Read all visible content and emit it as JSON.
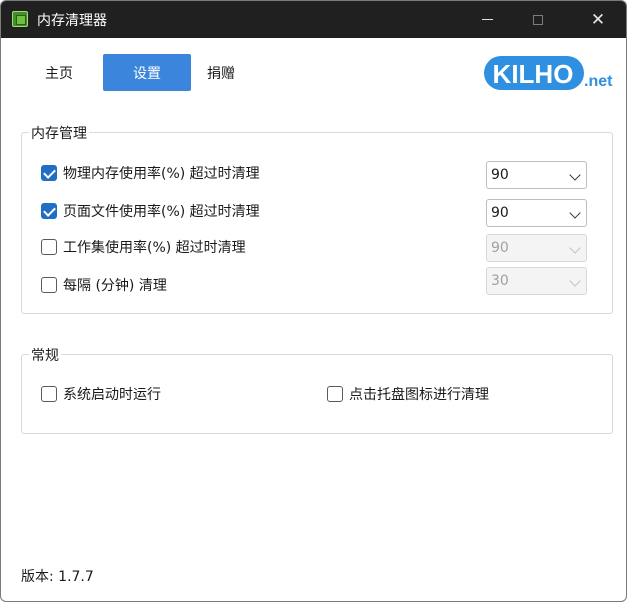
{
  "window": {
    "title": "内存清理器"
  },
  "tabs": [
    {
      "label": "主页"
    },
    {
      "label": "设置"
    },
    {
      "label": "捐赠"
    }
  ],
  "logo": {
    "text_main": "KILHO",
    "text_suffix": ".net",
    "color": "#2f8fe0"
  },
  "memory_group": {
    "title": "内存管理",
    "options": [
      {
        "label": "物理内存使用率(%) 超过时清理",
        "checked": true,
        "value": "90",
        "enabled": true
      },
      {
        "label": "页面文件使用率(%) 超过时清理",
        "checked": true,
        "value": "90",
        "enabled": true
      },
      {
        "label": "工作集使用率(%) 超过时清理",
        "checked": false,
        "value": "90",
        "enabled": false
      },
      {
        "label": "每隔 (分钟) 清理",
        "checked": false,
        "value": "30",
        "enabled": false
      }
    ]
  },
  "general_group": {
    "title": "常规",
    "options": [
      {
        "label": "系统启动时运行",
        "checked": false
      },
      {
        "label": "点击托盘图标进行清理",
        "checked": false
      }
    ]
  },
  "footer": {
    "version": "版本: 1.7.7"
  },
  "colors": {
    "accent": "#3b86dc",
    "titlebar": "#202020",
    "check": "#1f6fc5"
  }
}
